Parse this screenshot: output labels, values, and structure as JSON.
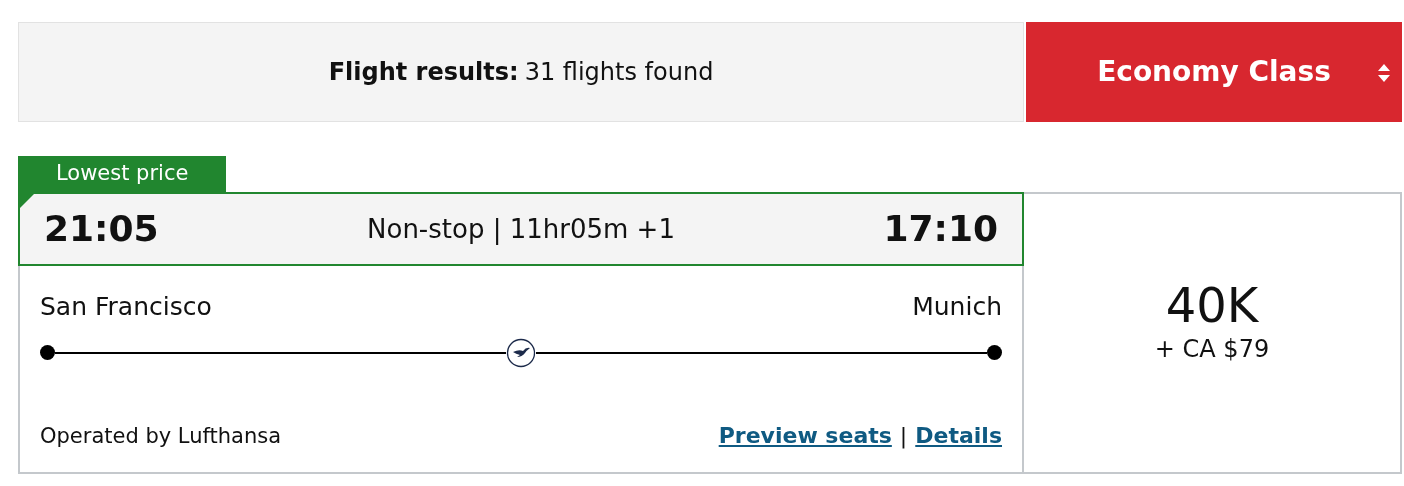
{
  "results_bar": {
    "label": "Flight results:",
    "count_text": "31 flights found"
  },
  "cabin_select": {
    "value": "Economy Class"
  },
  "flight": {
    "tag": "Lowest price",
    "depart_time": "21:05",
    "summary": "Non-stop | 11hr05m +1",
    "arrive_time": "17:10",
    "origin": "San Francisco",
    "destination": "Munich",
    "operator": "Operated by Lufthansa",
    "links": [
      "Preview seats",
      "Details"
    ],
    "link_separator": "|",
    "price": {
      "points": "40K",
      "fee": "+ CA $79"
    }
  }
}
